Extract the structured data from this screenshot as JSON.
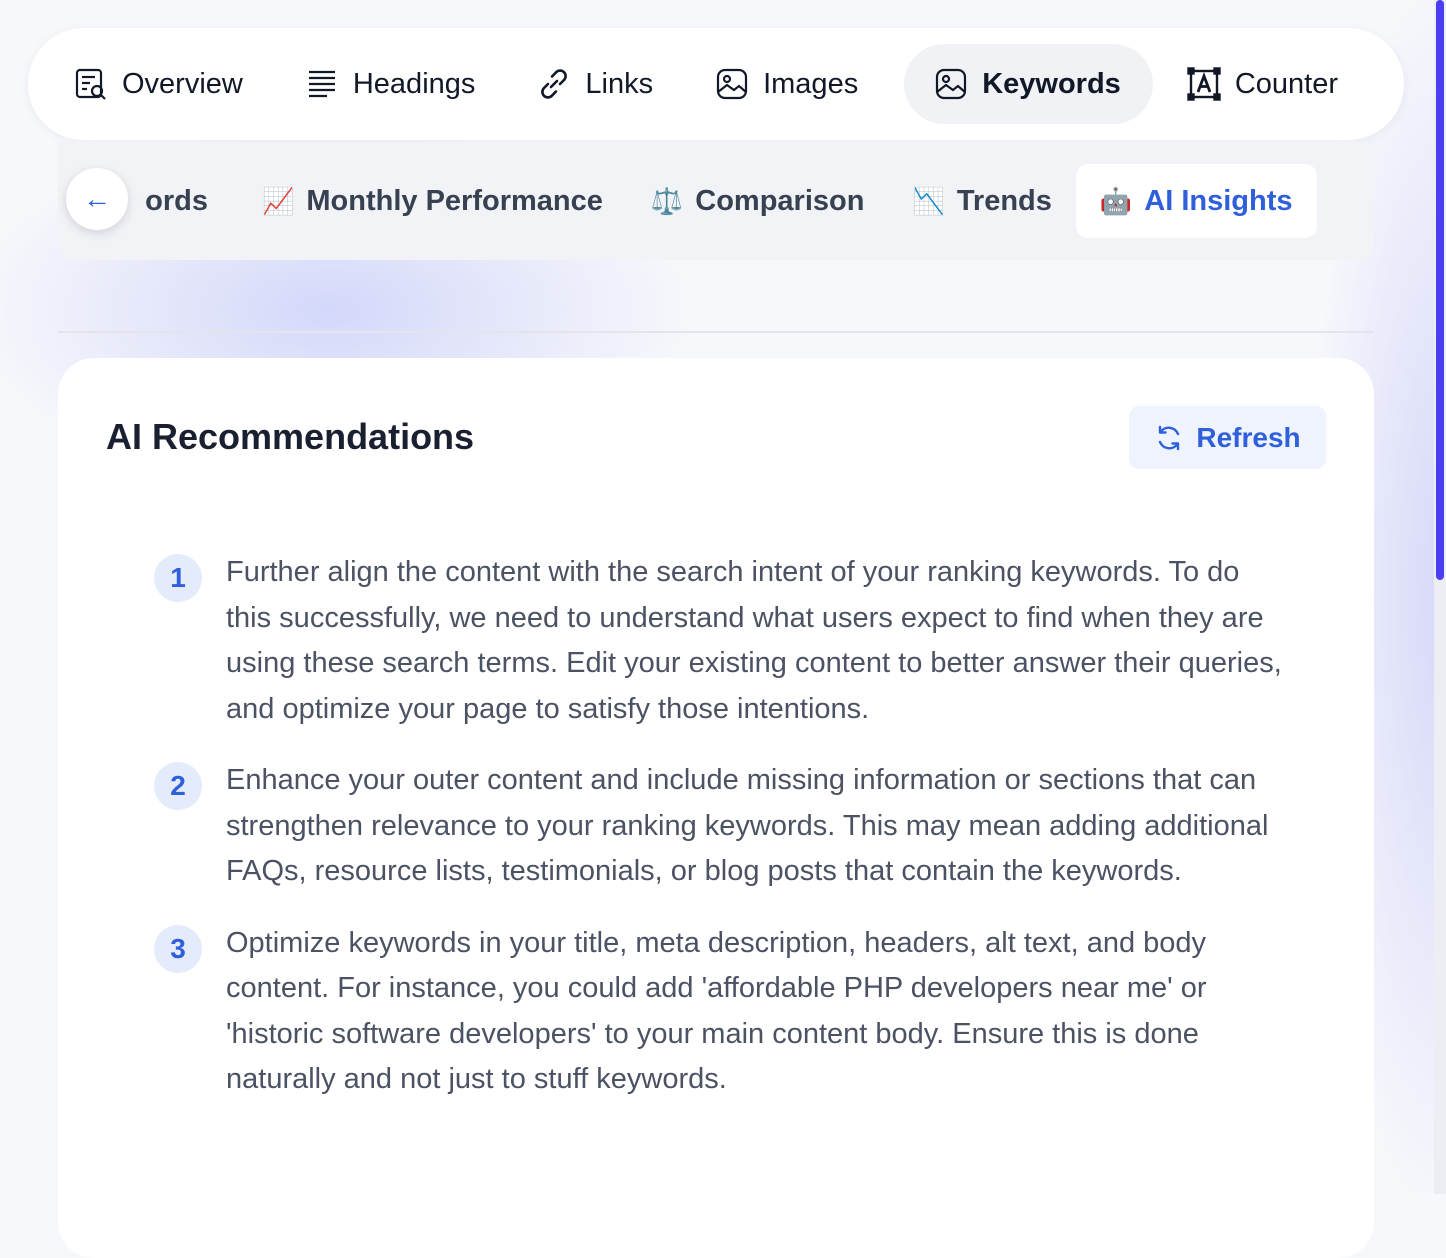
{
  "nav": {
    "items": [
      {
        "label": "Overview",
        "icon": "overview-icon",
        "active": false
      },
      {
        "label": "Headings",
        "icon": "headings-icon",
        "active": false
      },
      {
        "label": "Links",
        "icon": "link-icon",
        "active": false
      },
      {
        "label": "Images",
        "icon": "image-icon",
        "active": false
      },
      {
        "label": "Keywords",
        "icon": "image-icon",
        "active": true
      },
      {
        "label": "Counter",
        "icon": "text-counter-icon",
        "active": false
      }
    ]
  },
  "subtabs": {
    "back_label": "←",
    "items": [
      {
        "label": "ords",
        "emoji": ""
      },
      {
        "label": "Monthly Performance",
        "emoji": "📈"
      },
      {
        "label": "Comparison",
        "emoji": "⚖️"
      },
      {
        "label": "Trends",
        "emoji": "📉"
      },
      {
        "label": "AI Insights",
        "emoji": "🤖"
      }
    ]
  },
  "card": {
    "title": "AI Recommendations",
    "refresh_label": "Refresh",
    "recommendations": [
      {
        "num": "1",
        "text": "Further align the content with the search intent of your ranking keywords. To do this successfully, we need to understand what users expect to find when they are using these search terms. Edit your existing content to better answer their queries, and optimize your page to satisfy those intentions."
      },
      {
        "num": "2",
        "text": "Enhance your outer content and include missing information or sections that can strengthen relevance to your ranking keywords. This may mean adding additional FAQs, resource lists, testimonials, or blog posts that contain the keywords."
      },
      {
        "num": "3",
        "text": "Optimize keywords in your title, meta description, headers, alt text, and body content. For instance, you could add 'affordable PHP developers near me' or 'historic software developers' to your main content body. Ensure this is done naturally and not just to stuff keywords."
      }
    ]
  },
  "colors": {
    "accent": "#2f5fdb",
    "scrollbar": "#4a3ff0"
  }
}
